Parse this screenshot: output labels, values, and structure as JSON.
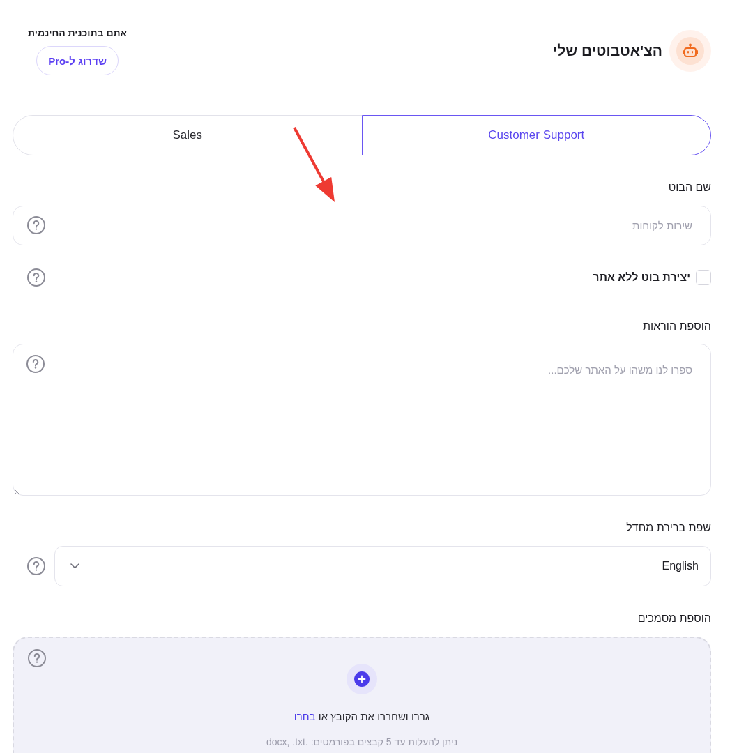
{
  "header": {
    "title": "הצ'אטבוטים שלי",
    "plan_text": "אתם בתוכנית החינמית",
    "upgrade_button": "שדרוג ל-Pro"
  },
  "tabs": [
    {
      "label": "Customer Support",
      "selected": true
    },
    {
      "label": "Sales",
      "selected": false
    }
  ],
  "form": [
    {
      "kind": "text",
      "label": "שם הבוט",
      "placeholder": "שירות לקוחות"
    },
    {
      "kind": "checkbox",
      "label": "יצירת בוט ללא אתר",
      "checked": false
    },
    {
      "kind": "textarea",
      "label": "הוספת הוראות",
      "placeholder": "ספרו לנו משהו על האתר שלכם..."
    },
    {
      "kind": "select",
      "label": "שפת ברירת מחדל",
      "value": "English"
    },
    {
      "kind": "upload",
      "label": "הוספת מסמכים",
      "drop_text": "גררו ושחררו את הקובץ או",
      "browse_link": "בחרו",
      "hint": "ניתן להעלות עד 5 קבצים בפורמטים: .docx, .txt"
    }
  ]
}
